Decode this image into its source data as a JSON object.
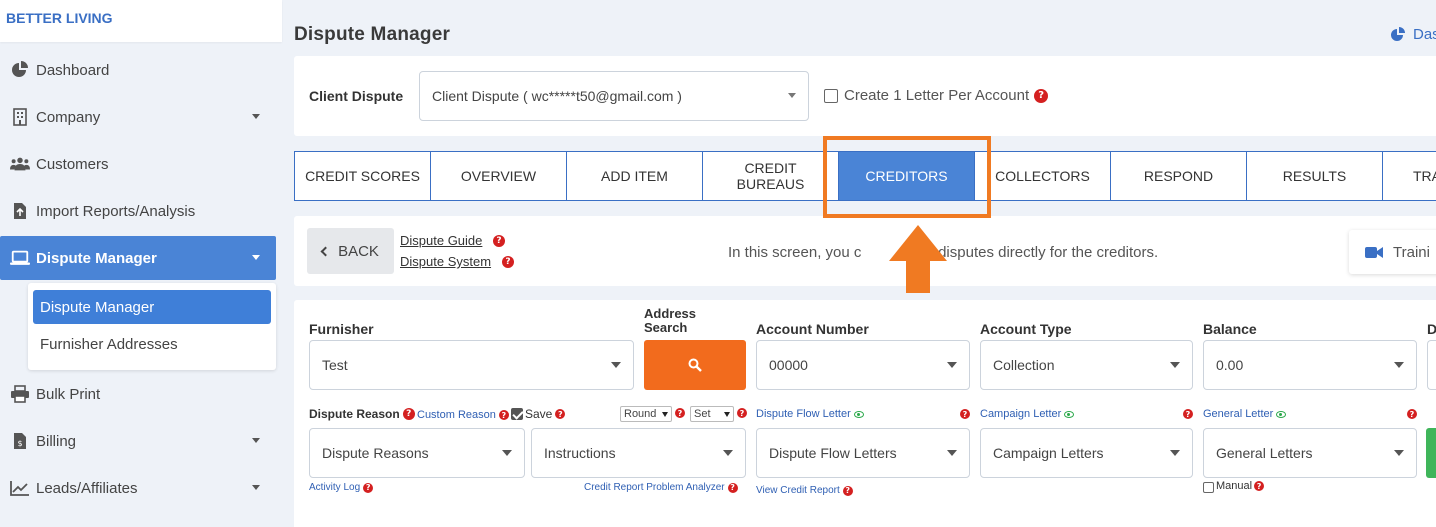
{
  "brand": "BETTER LIVING",
  "sidebar": {
    "items": [
      {
        "label": "Dashboard",
        "icon": "pie-chart-icon"
      },
      {
        "label": "Company",
        "icon": "building-icon"
      },
      {
        "label": "Customers",
        "icon": "users-icon"
      },
      {
        "label": "Import Reports/Analysis",
        "icon": "file-import-icon"
      },
      {
        "label": "Dispute Manager",
        "icon": "laptop-icon"
      },
      {
        "label": "Bulk Print",
        "icon": "printer-icon"
      },
      {
        "label": "Billing",
        "icon": "invoice-icon"
      },
      {
        "label": "Leads/Affiliates",
        "icon": "chart-line-icon"
      }
    ],
    "submenu": [
      "Dispute Manager",
      "Furnisher Addresses"
    ]
  },
  "page": {
    "title": "Dispute Manager",
    "dash_link": "Das"
  },
  "client": {
    "label": "Client Dispute",
    "select_value": "Client Dispute ( wc*****t50@gmail.com )",
    "checkbox_label": "Create 1 Letter Per Account"
  },
  "tabs": [
    "CREDIT SCORES",
    "OVERVIEW",
    "ADD ITEM",
    "CREDIT BUREAUS",
    "CREDITORS",
    "COLLECTORS",
    "RESPOND",
    "RESULTS",
    "TRA"
  ],
  "active_tab": "CREDITORS",
  "guide": {
    "back": "BACK",
    "guide_link": "Dispute Guide",
    "system_link": "Dispute System",
    "info_left": "In this screen, you c",
    "info_right": "te disputes directly for the creditors.",
    "training": "Traini"
  },
  "form": {
    "furnisher_label": "Furnisher",
    "furnisher_value": "Test",
    "address_search_label": "Address Search",
    "account_number_label": "Account Number",
    "account_number_value": "00000",
    "account_type_label": "Account Type",
    "account_type_value": "Collection",
    "balance_label": "Balance",
    "balance_value": "0.00",
    "next_label": "D",
    "dispute_reason_label": "Dispute Reason",
    "custom_reason": "Custom Reason",
    "save_label": "Save",
    "round_value": "Round",
    "set_value": "Set",
    "dispute_flow_letter": "Dispute Flow Letter",
    "campaign_letter": "Campaign Letter",
    "general_letter": "General Letter",
    "dispute_reasons_value": "Dispute Reasons",
    "instructions_value": "Instructions",
    "dispute_flow_letters_value": "Dispute Flow Letters",
    "campaign_letters_value": "Campaign Letters",
    "general_letters_value": "General Letters",
    "activity_log": "Activity Log",
    "problem_analyzer": "Credit Report Problem Analyzer",
    "view_credit_report": "View Credit Report",
    "manual_label": "Manual"
  },
  "colors": {
    "accent": "#4a84d6",
    "highlight": "#f07a22",
    "search_button": "#f26b1d",
    "help": "#d42020"
  }
}
